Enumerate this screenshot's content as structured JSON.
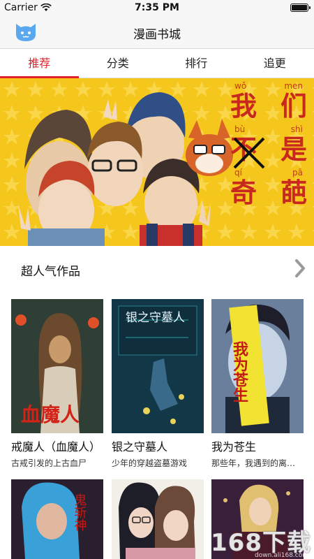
{
  "status_bar": {
    "carrier": "Carrier",
    "time": "7:35 PM",
    "wifi_icon": "wifi-icon",
    "battery_icon": "battery-icon"
  },
  "nav": {
    "title": "漫画书城",
    "logo_icon": "cat-logo-icon"
  },
  "tabs": [
    {
      "label": "推荐",
      "active": true
    },
    {
      "label": "分类",
      "active": false
    },
    {
      "label": "排行",
      "active": false
    },
    {
      "label": "追更",
      "active": false
    }
  ],
  "banner": {
    "pinyin": [
      "wǒ",
      "men",
      "bù",
      "shì",
      "qí",
      "pā"
    ],
    "hanzi": [
      "我",
      "们",
      "不",
      "是",
      "奇",
      "葩"
    ]
  },
  "section": {
    "title": "超人气作品",
    "arrow_icon": "chevron-right-icon"
  },
  "comics": [
    {
      "title": "戒魔人（血魔人）",
      "desc": "古戒引发的上古血尸",
      "cover_text": "血魔人"
    },
    {
      "title": "银之守墓人",
      "desc": "少年的穿越盗墓游戏",
      "cover_text": "银之守墓人"
    },
    {
      "title": "我为苍生",
      "desc": "那些年，我遇到的离奇事件",
      "cover_text": "我为苍生"
    },
    {
      "title": "",
      "desc": "",
      "cover_text": "鬼斩神"
    },
    {
      "title": "",
      "desc": "",
      "cover_text": ""
    },
    {
      "title": "",
      "desc": "",
      "cover_text": ""
    }
  ],
  "watermark": {
    "main": "168下载",
    "sub": "down.ali168.com"
  },
  "colors": {
    "accent": "#e3202a",
    "banner_bg": "#f5c61c",
    "nav_bg": "#f7f7f7"
  }
}
